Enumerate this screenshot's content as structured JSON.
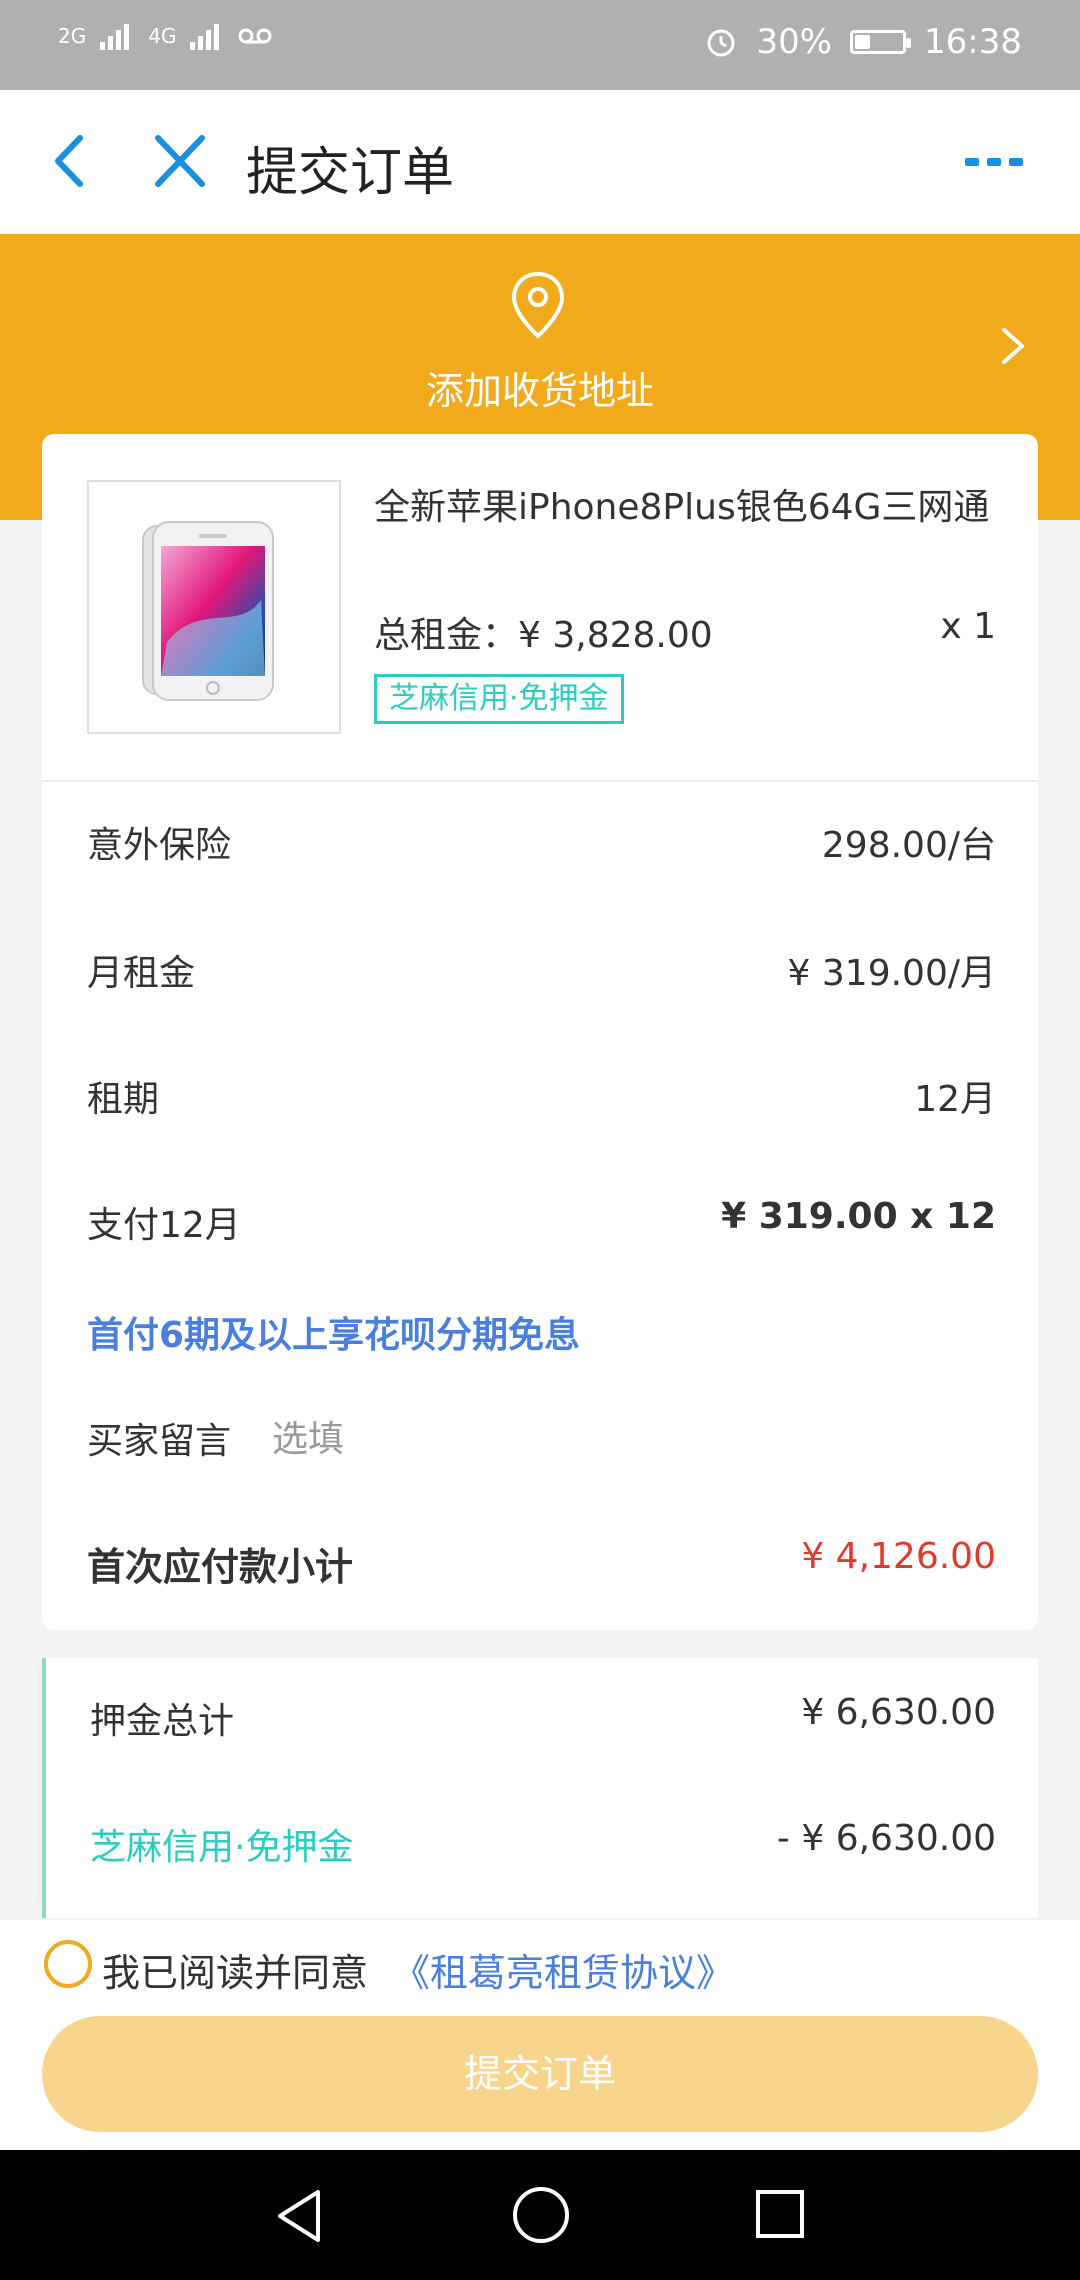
{
  "status_bar": {
    "network_left": "2G",
    "network_right": "4G",
    "voicemail_icon": "voicemail-icon",
    "alarm_icon": "alarm-icon",
    "battery_percent": "30%",
    "battery_level": 0.3,
    "time": "16:38"
  },
  "header": {
    "title": "提交订单",
    "back_icon": "chevron-left-icon",
    "close_icon": "close-icon",
    "more_icon": "more-dots-icon",
    "accent_color": "#1a8fdf"
  },
  "address": {
    "label": "添加收货地址",
    "icon": "location-pin-icon",
    "banner_color": "#f0aa1c"
  },
  "product": {
    "name": "全新苹果iPhone8Plus银色64G三网通",
    "total_rent_label": "总租金：",
    "total_rent_value": "¥ 3,828.00",
    "quantity": "x 1",
    "tag": "芝麻信用·免押金",
    "image_icon": "iphone-product-image"
  },
  "details": {
    "rows": [
      {
        "label": "意外保险",
        "value": "298.00/台"
      },
      {
        "label": "月租金",
        "value": "¥ 319.00/月"
      },
      {
        "label": "租期",
        "value": "12月"
      },
      {
        "label": "支付12月",
        "value": "¥ 319.00 x 12"
      }
    ],
    "promo": "首付6期及以上享花呗分期免息",
    "message_label": "买家留言",
    "message_placeholder": "选填",
    "subtotal_label": "首次应付款小计",
    "subtotal_value": "¥ 4,126.00"
  },
  "deposit": {
    "total_label": "押金总计",
    "total_value": "¥ 6,630.00",
    "credit_label": "芝麻信用·免押金",
    "credit_value": "- ¥ 6,630.00"
  },
  "agreement": {
    "text": "我已阅读并同意",
    "link": "《租葛亮租赁协议》"
  },
  "submit": {
    "label": "提交订单"
  },
  "nav": {
    "back_icon": "nav-back-icon",
    "home_icon": "nav-home-icon",
    "recent_icon": "nav-recent-icon"
  }
}
